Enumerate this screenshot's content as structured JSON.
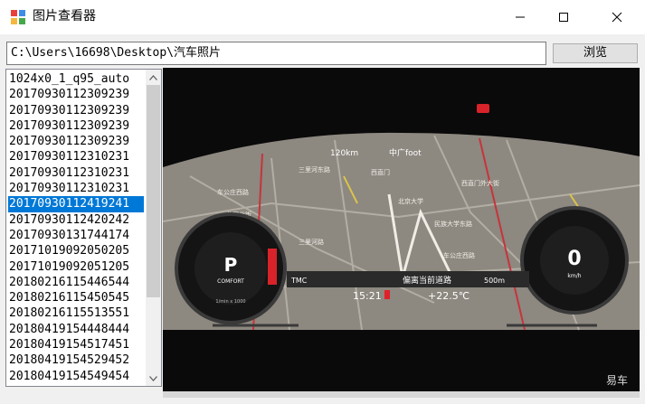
{
  "window": {
    "title": "图片查看器"
  },
  "toolbar": {
    "path_value": "C:\\Users\\16698\\Desktop\\汽车照片",
    "browse_label": "浏览"
  },
  "file_list": {
    "selected_index": 8,
    "items": [
      "1024x0_1_q95_auto",
      "20170930112309239",
      "20170930112309239",
      "20170930112309239",
      "20170930112309239",
      "20170930112310231",
      "20170930112310231",
      "20170930112310231",
      "20170930112419241",
      "20170930112420242",
      "20170930131744174",
      "20171019092050205",
      "20171019092051205",
      "20180216115446544",
      "20180216115450545",
      "20180216115513551",
      "20180419154448444",
      "20180419154517451",
      "20180419154529452",
      "20180419154549454"
    ]
  },
  "preview": {
    "nav_street": "偏离当前道路",
    "distance": "500m",
    "tmc": "TMC",
    "clock": "15:21",
    "outside_temp": "+22.5℃",
    "range": "120km",
    "radio": "中广foot",
    "gear": "P",
    "drive_mode": "COMFORT",
    "rpm_unit": "1/min x 1000",
    "speed": "0",
    "speed_unit": "km/h",
    "map_labels": [
      "三里河东路",
      "西直门",
      "北京大学",
      "车公庄西路",
      "西直门外大街",
      "北展北街",
      "民族大学东路",
      "三里河路",
      "车公庄西路"
    ],
    "watermark": "易车",
    "colors": {
      "map_bg": "#8d8880",
      "warning": "#e0202a",
      "selection": "#0078d7"
    }
  }
}
